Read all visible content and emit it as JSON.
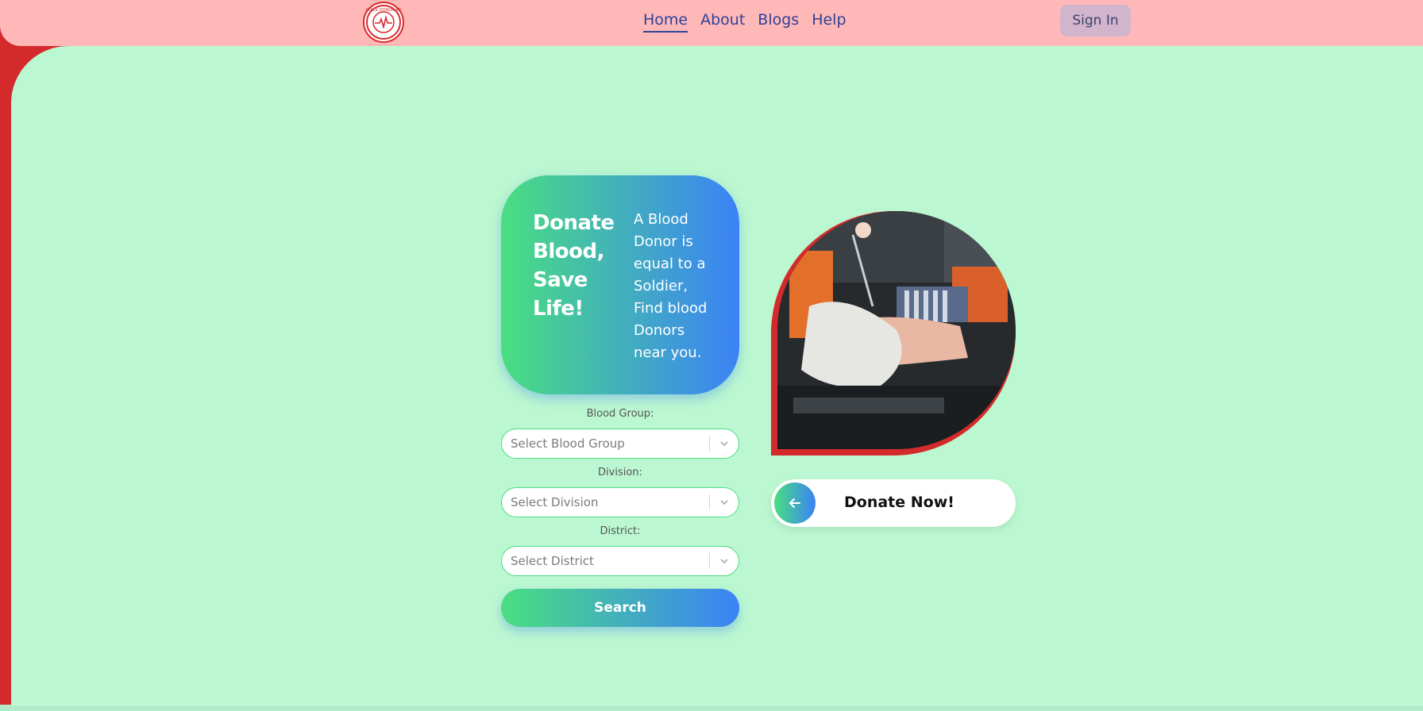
{
  "header": {
    "logo_text": "QUICK DONOR BD",
    "nav": [
      {
        "label": "Home",
        "active": true
      },
      {
        "label": "About",
        "active": false
      },
      {
        "label": "Blogs",
        "active": false
      },
      {
        "label": "Help",
        "active": false
      }
    ],
    "signin_label": "Sign In"
  },
  "hero": {
    "title": "Donate Blood, Save Life!",
    "tagline": "A Blood Donor is equal to a Soldier, Find blood Donors near you."
  },
  "search_form": {
    "blood_group": {
      "label": "Blood Group:",
      "placeholder": "Select Blood Group"
    },
    "division": {
      "label": "Division:",
      "placeholder": "Select Division"
    },
    "district": {
      "label": "District:",
      "placeholder": "Select District"
    },
    "search_label": "Search"
  },
  "donate": {
    "label": "Donate Now!",
    "icon": "arrow-left-icon"
  },
  "colors": {
    "header_bg": "#ffb8b8",
    "main_bg": "#bbf7d0",
    "accent_red": "#d42a2c",
    "gradient_start": "#4ade80",
    "gradient_end": "#3b82f6",
    "nav_text": "#2e4296"
  }
}
